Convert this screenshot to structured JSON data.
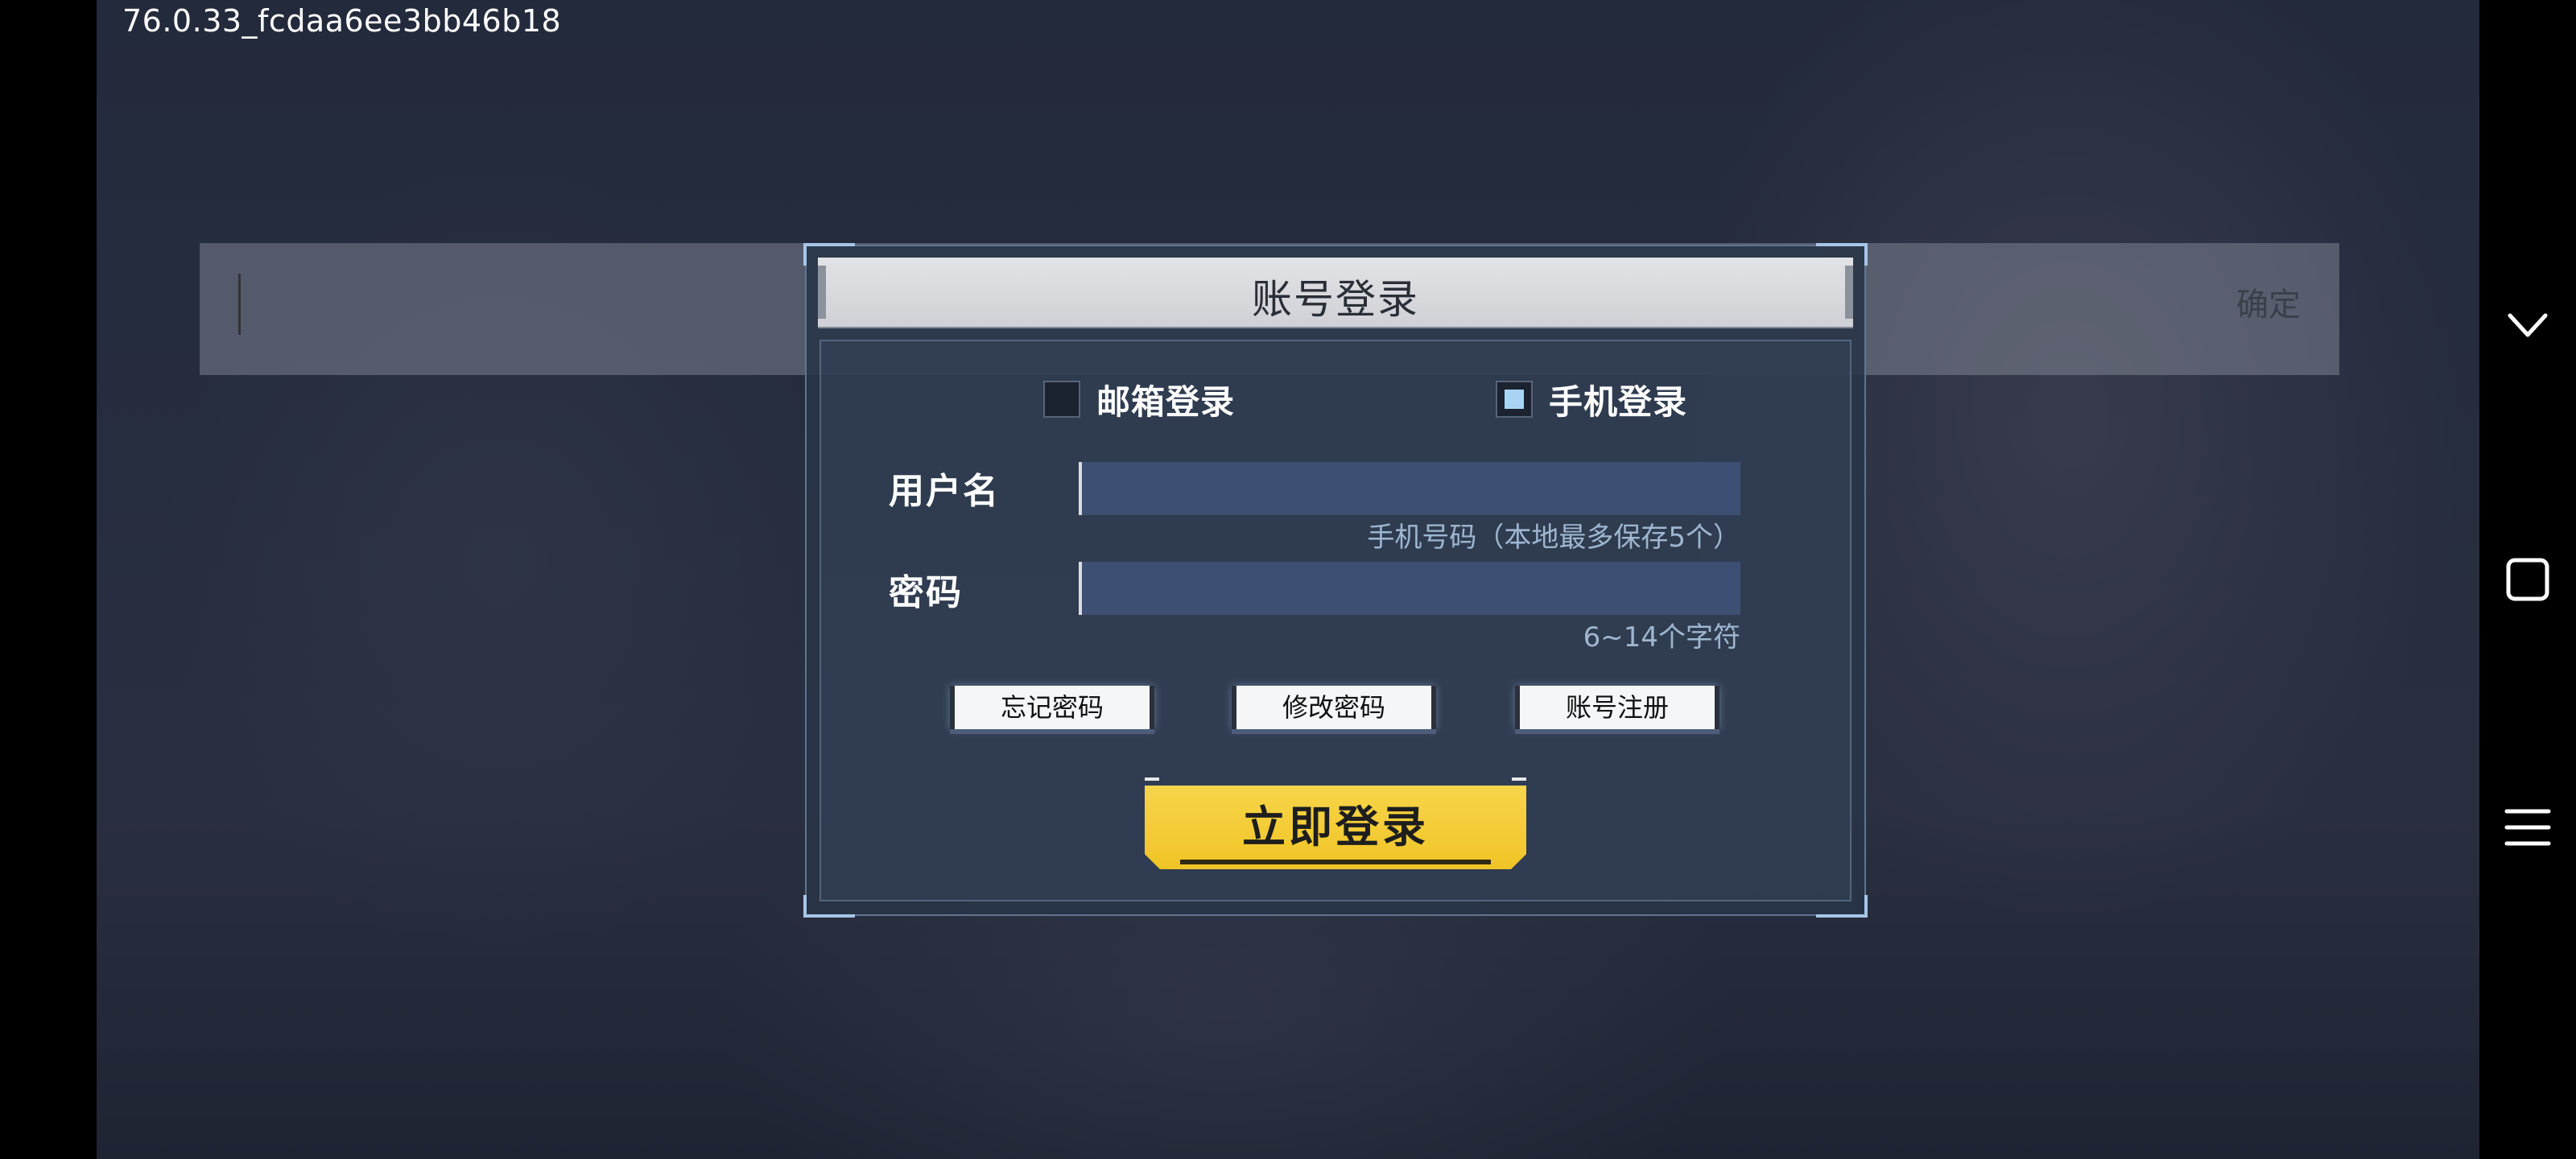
{
  "status": {
    "version": "76.0.33_fcdaa6ee3bb46b18"
  },
  "input_strip": {
    "confirm_label": "确定"
  },
  "dialog": {
    "title": "账号登录",
    "modes": [
      {
        "label": "邮箱登录",
        "checked": false
      },
      {
        "label": "手机登录",
        "checked": true
      }
    ],
    "username": {
      "label": "用户名",
      "value": "",
      "hint": "手机号码（本地最多保存5个）"
    },
    "password": {
      "label": "密码",
      "value": "",
      "hint": "6~14个字符"
    },
    "buttons": {
      "forgot": "忘记密码",
      "change": "修改密码",
      "register": "账号注册"
    },
    "login_label": "立即登录"
  },
  "nav": {
    "icons": [
      "chevron-down-icon",
      "square-icon",
      "menu-icon"
    ]
  },
  "colors": {
    "accent_yellow": "#f2c830",
    "checkbox_checked": "#a8d4f4",
    "input_bg": "#3d4f72"
  }
}
